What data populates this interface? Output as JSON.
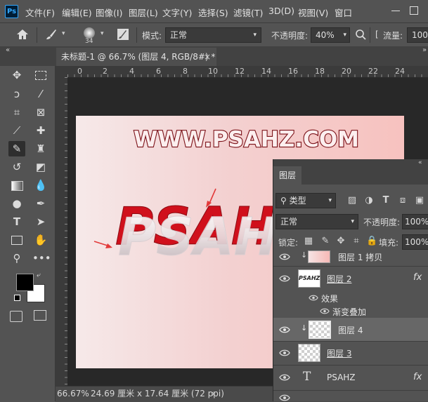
{
  "menubar": {
    "logo": "Ps",
    "items": [
      "文件(F)",
      "编辑(E)",
      "图像(I)",
      "图层(L)",
      "文字(Y)",
      "选择(S)",
      "滤镜(T)",
      "3D(D)",
      "视图(V)",
      "窗口"
    ]
  },
  "options": {
    "brush_size": "34",
    "mode_label": "模式:",
    "mode_value": "正常",
    "opacity_label": "不透明度:",
    "opacity_value": "40%",
    "flow_label": "流量:",
    "flow_value": "100"
  },
  "document_tab": {
    "title": "未标题-1 @ 66.7% (图层 4, RGB/8#) *",
    "close": "×"
  },
  "ruler": {
    "ticks": [
      "0",
      "2",
      "4",
      "6",
      "8",
      "10",
      "12",
      "14",
      "16",
      "18",
      "20",
      "22",
      "24"
    ]
  },
  "canvas": {
    "headline": "WWW.PSAHZ.COM",
    "art_text": "PSAHZ",
    "colors": {
      "headline_fill": "#fcefef",
      "headline_stroke": "#7a0f16",
      "art_red": "#d0101c",
      "arrow": "#e23a3a"
    }
  },
  "status": {
    "zoom": "66.67%",
    "doc_size": "24.69 厘米 x 17.64 厘米 (72 ppi)",
    "arrow": "›"
  },
  "layers_panel": {
    "tab_label": "图层",
    "filter_label": "类型",
    "blend_mode": "正常",
    "opacity_label": "不透明度:",
    "opacity_value": "100%",
    "lock_label": "锁定:",
    "fill_label": "填充:",
    "fill_value": "100%",
    "effects_label": "效果",
    "gradient_overlay_label": "渐变叠加",
    "layers": [
      {
        "name": "图层 1 拷贝"
      },
      {
        "name": "图层 2",
        "thumb_text": "PSAHZ",
        "fx": "fx"
      },
      {
        "name": "图层 4"
      },
      {
        "name": "图层 3"
      },
      {
        "name": "PSAHZ",
        "type_glyph": "T",
        "fx": "fx"
      }
    ]
  }
}
